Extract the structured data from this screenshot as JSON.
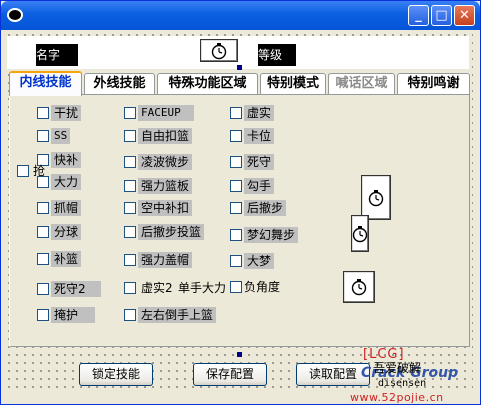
{
  "window": {
    "controls": {
      "minimize": "_",
      "maximize": "□",
      "close": "✕"
    }
  },
  "header": {
    "name_label": "名字",
    "level_label": "等级"
  },
  "tabs": [
    "内线技能",
    "外线技能",
    "特殊功能区域",
    "特别模式",
    "喊话区域",
    "特别鸣谢"
  ],
  "skills": {
    "col1": [
      "干扰",
      "SS",
      "快补",
      "大力",
      "抓帽",
      "分球",
      "补篮",
      "死守2",
      "掩护"
    ],
    "col2": [
      "FACEUP",
      "自由扣篮",
      "凌波微步",
      "强力篮板",
      "空中补扣",
      "后撤步投篮",
      "强力盖帽",
      "虚实2",
      "左右倒手上篮"
    ],
    "col3": [
      "虚实",
      "卡位",
      "死守",
      "勾手",
      "后撤步",
      "梦幻舞步",
      "大梦",
      "负角度"
    ],
    "hidden_cb": "抢",
    "one_hand": "单手大力"
  },
  "buttons": {
    "lock": "锁定技能",
    "save": "保存配置",
    "read": "读取配置",
    "about": "吾爱破解"
  },
  "branding": {
    "lcg": "[LCG]",
    "group": "Crack Group",
    "author": "disensen",
    "url": "www.52pojie.cn"
  }
}
